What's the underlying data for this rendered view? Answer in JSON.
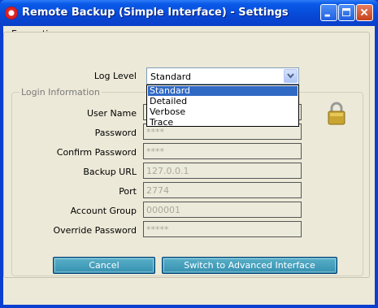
{
  "window": {
    "title": "Remote Backup (Simple Interface) - Settings"
  },
  "menu": {
    "items": [
      "Encryption"
    ]
  },
  "log_level": {
    "label": "Log Level",
    "selected": "Standard",
    "options": [
      "Standard",
      "Detailed",
      "Verbose",
      "Trace"
    ],
    "highlighted_option": "Standard"
  },
  "login_info": {
    "legend": "Login Information",
    "user_name_label": "User Name",
    "password_label": "Password",
    "password_value": "****",
    "confirm_password_label": "Confirm Password",
    "confirm_password_value": "****",
    "backup_url_label": "Backup URL",
    "backup_url_value": "127.0.0.1",
    "port_label": "Port",
    "port_value": "2774",
    "account_group_label": "Account Group",
    "account_group_value": "000001",
    "override_password_label": "Override Password",
    "override_password_value": "*****"
  },
  "buttons": {
    "cancel": "Cancel",
    "switch": "Switch to Advanced Interface"
  },
  "colors": {
    "titlebar": "#0748d6",
    "button": "#3490b0",
    "selection": "#316ac5"
  },
  "icons": [
    "app-icon",
    "minimize-icon",
    "maximize-icon",
    "close-icon",
    "chevron-down-icon",
    "padlock-icon"
  ]
}
